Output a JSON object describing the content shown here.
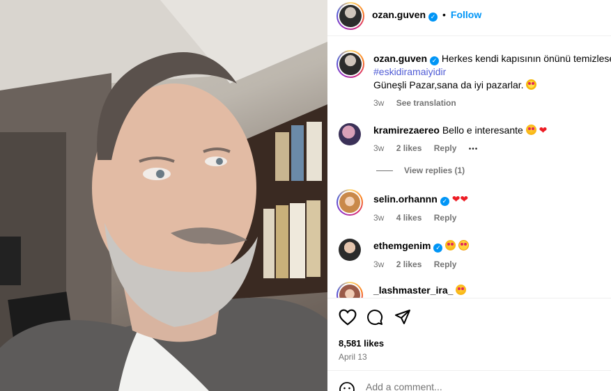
{
  "post": {
    "author": "ozan.guven",
    "follow_label": "Follow",
    "separator": "•",
    "caption_line1": "Herkes kendi kapısının önünü temizlese!",
    "hashtag": "#eskidiramaiyidir",
    "caption_line2": "Güneşli Pazar,sana da iyi pazarlar.",
    "time": "3w",
    "see_translation": "See translation"
  },
  "comments": [
    {
      "user": "kramirezaereo",
      "text": "Bello e interesante",
      "time": "3w",
      "likes": "2 likes",
      "reply": "Reply",
      "more": "•••",
      "view_replies": "View replies (1)"
    },
    {
      "user": "selin.orhannn",
      "text": "",
      "time": "3w",
      "likes": "4 likes",
      "reply": "Reply"
    },
    {
      "user": "ethemgenim",
      "text": "",
      "time": "3w",
      "likes": "2 likes",
      "reply": "Reply"
    },
    {
      "user": "_lashmaster_ira_",
      "text": ""
    }
  ],
  "stats": {
    "likes": "8,581 likes",
    "date": "April 13"
  },
  "comment_box": {
    "placeholder": "Add a comment..."
  },
  "icons": [
    "heart-icon",
    "comment-icon",
    "share-icon",
    "verified-icon",
    "emoji-icon"
  ],
  "colors": {
    "accent": "#0095f6",
    "hashtag": "#4f5bd5",
    "muted": "#737373"
  }
}
